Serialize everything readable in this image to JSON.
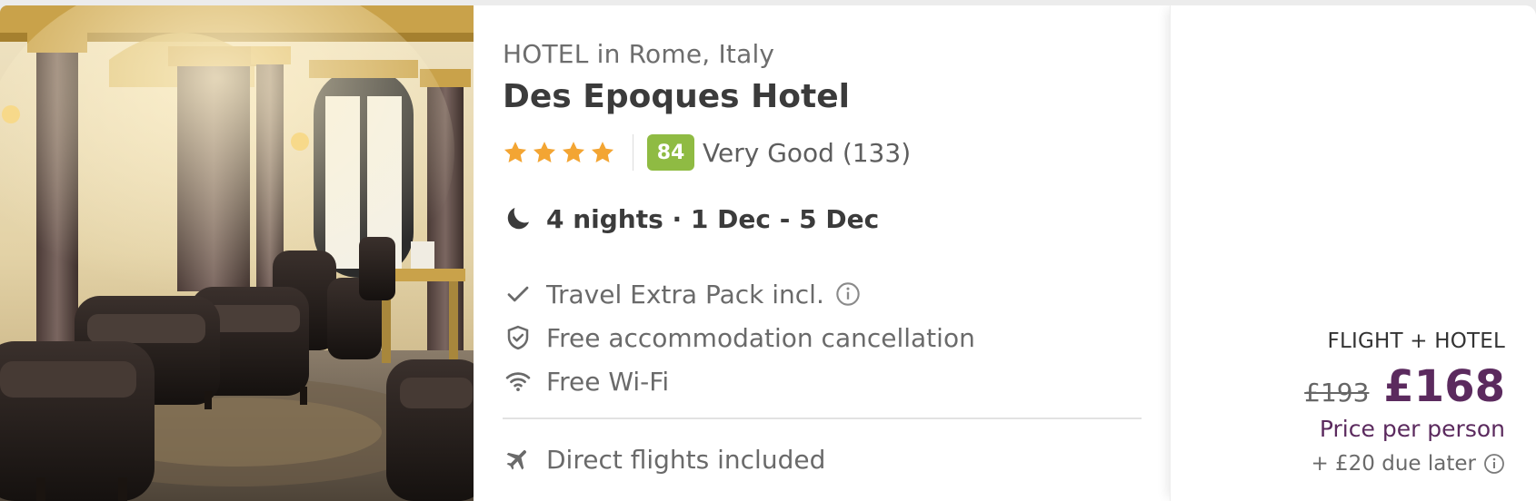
{
  "hotel": {
    "location": "HOTEL in Rome, Italy",
    "name": "Des Epoques Hotel",
    "stars": 4,
    "score": "84",
    "score_text": "Very Good (133)"
  },
  "stay": {
    "summary": "4 nights · 1 Dec - 5 Dec",
    "icon": "moon-icon"
  },
  "features": [
    {
      "icon": "check-icon",
      "label": "Travel Extra Pack incl.",
      "has_info": true
    },
    {
      "icon": "shield-check-icon",
      "label": "Free accommodation cancellation"
    },
    {
      "icon": "wifi-icon",
      "label": "Free Wi-Fi"
    },
    {
      "icon": "airplane-icon",
      "label": "Direct flights included"
    }
  ],
  "pricing": {
    "package_label": "FLIGHT + HOTEL",
    "old_price": "£193",
    "new_price": "£168",
    "per_person": "Price per person",
    "due_later": "+ £20 due later"
  },
  "colors": {
    "score_badge": "#8fbb43",
    "price": "#5b2a5e",
    "star": "#f3a533"
  }
}
